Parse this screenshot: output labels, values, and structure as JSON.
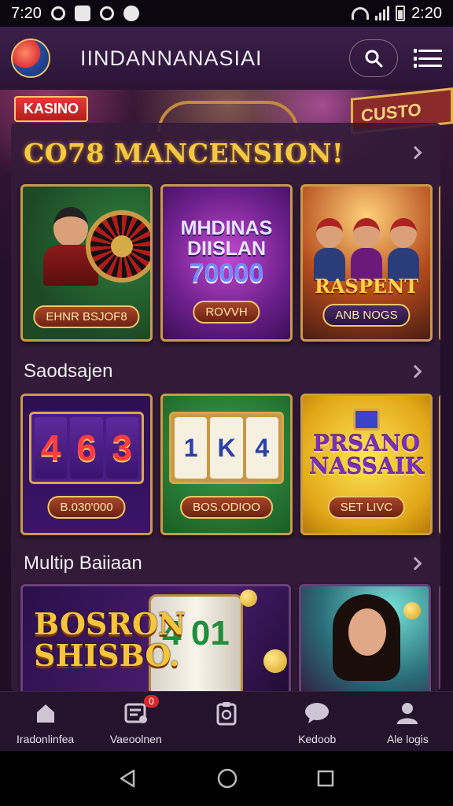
{
  "status_bar": {
    "time_left": "7:20",
    "time_right": "2:20"
  },
  "header": {
    "title": "IINDANNANASIAI",
    "search_icon": "search-icon",
    "menu_icon": "menu-icon"
  },
  "badge": {
    "label": "KASINO"
  },
  "sections": [
    {
      "title": "CO78 MANCENSION!",
      "cards": [
        {
          "art_name": "roulette-dealer",
          "label": "EHNR BSJOF8"
        },
        {
          "art_title": "MHDINAS DIISLAN",
          "art_number": "70000",
          "label": "ROVVH"
        },
        {
          "art_title": "RASPENT",
          "label": "ANB NOGS"
        }
      ]
    },
    {
      "title": "Saodsajen",
      "cards": [
        {
          "reels": [
            "4",
            "6",
            "3"
          ],
          "label": "B.030'000"
        },
        {
          "reels": [
            "1",
            "K",
            "4"
          ],
          "label": "BOS.ODIOO"
        },
        {
          "art_title": "PRSANO NASSAIK",
          "label": "SET LIVC"
        }
      ]
    },
    {
      "title": "Multip Baiiaan",
      "cards": [
        {
          "art_title": "BOSRON SHISBO.",
          "reel_text": "4 01"
        },
        {
          "art_name": "woman-presenter"
        }
      ]
    }
  ],
  "bottom_nav": [
    {
      "label": "Iradonlinfea",
      "icon": "home-icon"
    },
    {
      "label": "Vaeoolnen",
      "icon": "ticket-icon",
      "badge": "0"
    },
    {
      "label": "",
      "icon": "clipboard-icon"
    },
    {
      "label": "Kedoob",
      "icon": "chat-icon"
    },
    {
      "label": "Ale logis",
      "icon": "user-icon"
    }
  ],
  "colors": {
    "accent_gold": "#f5c842",
    "header_bg": "#2b1436",
    "panel_bg": "#341b3a",
    "badge_red": "#d9262b"
  }
}
